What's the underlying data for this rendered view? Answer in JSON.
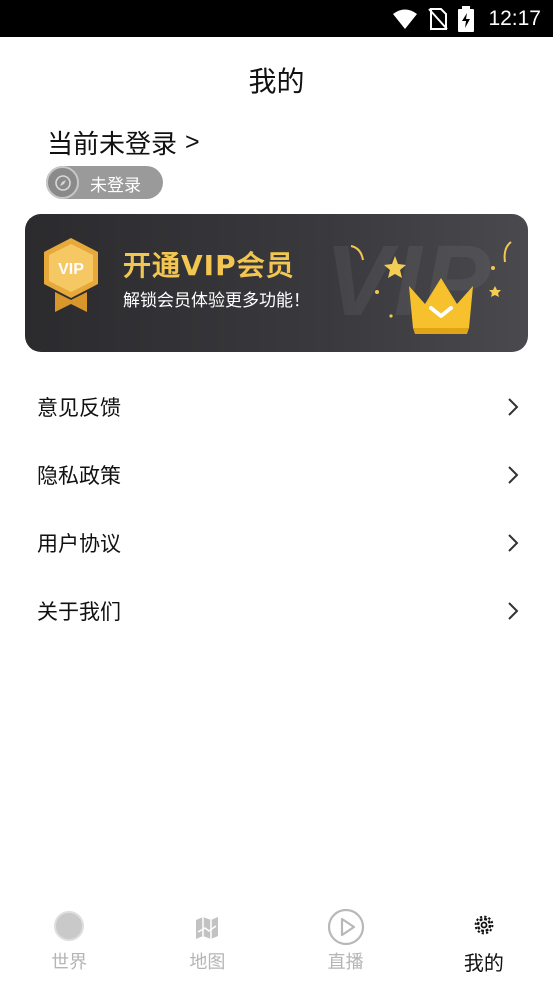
{
  "status_bar": {
    "time": "12:17",
    "icons": [
      "wifi-icon",
      "no-sim-icon",
      "battery-charging-icon"
    ]
  },
  "header": {
    "title": "我的"
  },
  "login": {
    "prompt": "当前未登录",
    "arrow": ">",
    "badge_label": "未登录"
  },
  "vip": {
    "title": "开通VIP会员",
    "subtitle": "解锁会员体验更多功能！",
    "shield_text": "VIP",
    "accent_color": "#f2c650"
  },
  "menu": {
    "items": [
      {
        "label": "意见反馈"
      },
      {
        "label": "隐私政策"
      },
      {
        "label": "用户协议"
      },
      {
        "label": "关于我们"
      }
    ]
  },
  "bottom_nav": {
    "items": [
      {
        "label": "世界",
        "icon": "globe-icon",
        "active": false
      },
      {
        "label": "地图",
        "icon": "map-icon",
        "active": false
      },
      {
        "label": "直播",
        "icon": "play-icon",
        "active": false
      },
      {
        "label": "我的",
        "icon": "gear-icon",
        "active": true
      }
    ]
  }
}
